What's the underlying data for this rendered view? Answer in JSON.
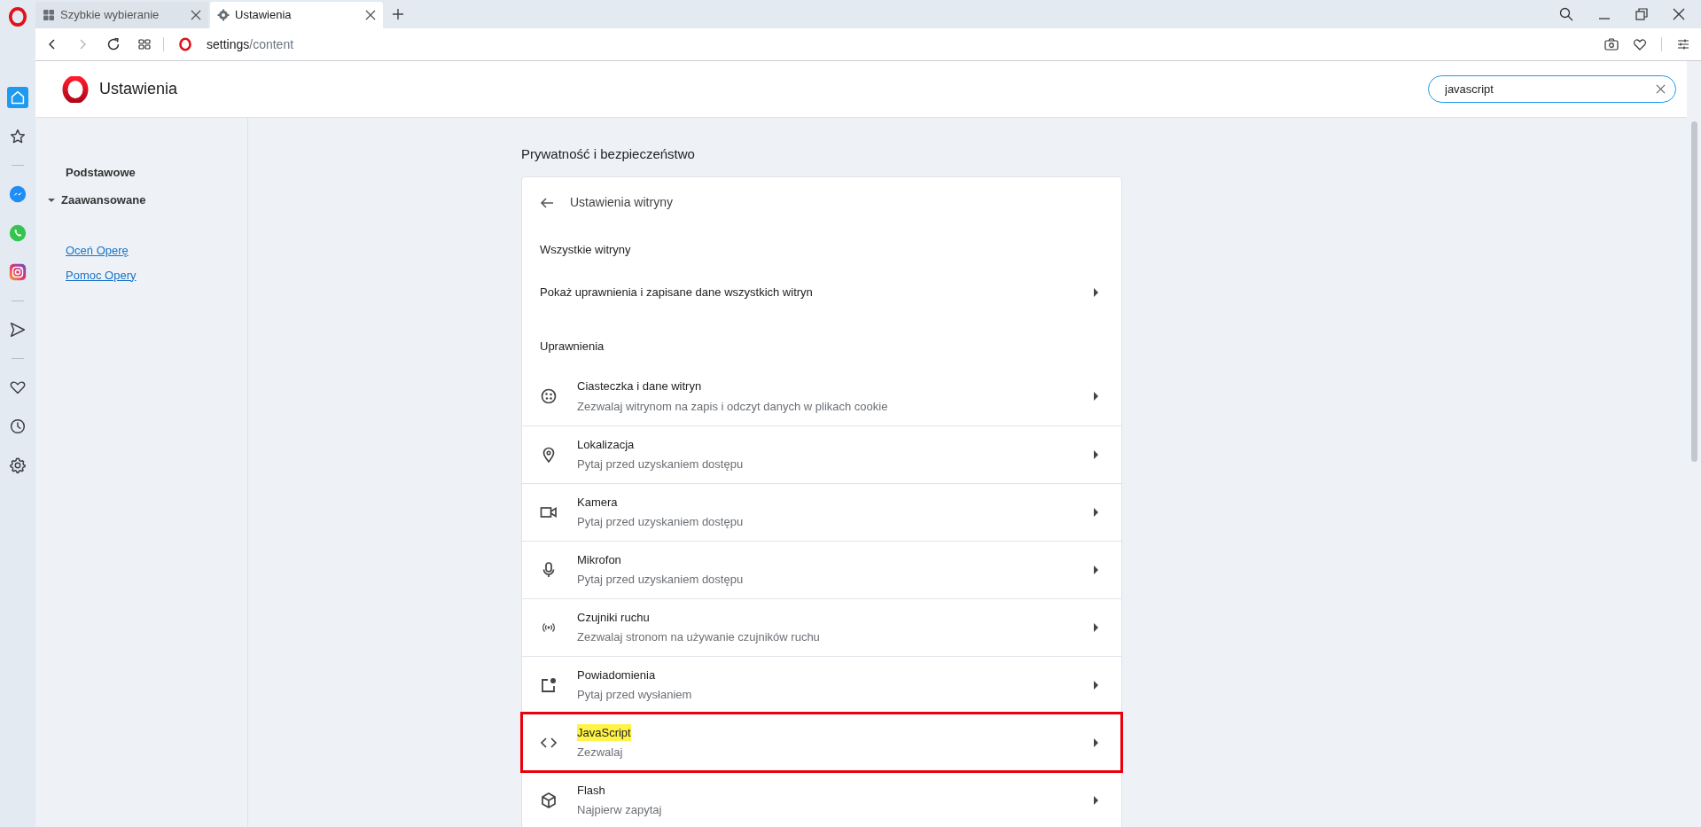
{
  "sidebar": {
    "items": [
      {
        "kind": "home",
        "selected": true
      },
      {
        "kind": "star",
        "selected": false
      },
      {
        "kind": "divider"
      },
      {
        "kind": "messenger",
        "selected": false
      },
      {
        "kind": "whatsapp",
        "selected": false
      },
      {
        "kind": "instagram",
        "selected": false
      },
      {
        "kind": "divider"
      },
      {
        "kind": "send",
        "selected": false
      },
      {
        "kind": "divider"
      },
      {
        "kind": "heart",
        "selected": false
      },
      {
        "kind": "clock",
        "selected": false
      },
      {
        "kind": "gear",
        "selected": false
      }
    ]
  },
  "tabs": [
    {
      "label": "Szybkie wybieranie",
      "kind": "grid",
      "selected": false
    },
    {
      "label": "Ustawienia",
      "kind": "gear",
      "selected": true
    }
  ],
  "address": {
    "host": "settings",
    "path": "/content"
  },
  "settings_header": {
    "title": "Ustawienia",
    "search": {
      "value": "javascript"
    }
  },
  "nav": {
    "items": [
      {
        "label": "Podstawowe",
        "kind": "plain"
      },
      {
        "label": "Zaawansowane",
        "kind": "expandable",
        "expanded": true
      }
    ],
    "links": [
      "Oceń Operę",
      "Pomoc Opery"
    ]
  },
  "section": {
    "title": "Prywatność i bezpieczeństwo",
    "card": {
      "title": "Ustawienia witryny",
      "all_sites_heading": "Wszystkie witryny",
      "all_sites_row": "Pokaż uprawnienia i zapisane dane wszystkich witryn",
      "permissions_heading": "Uprawnienia",
      "rows": [
        {
          "kind": "cookie",
          "title": "Ciasteczka i dane witryn",
          "subtitle": "Zezwalaj witrynom na zapis i odczyt danych w plikach cookie",
          "highlighted": false
        },
        {
          "kind": "location",
          "title": "Lokalizacja",
          "subtitle": "Pytaj przed uzyskaniem dostępu",
          "highlighted": false
        },
        {
          "kind": "camera",
          "title": "Kamera",
          "subtitle": "Pytaj przed uzyskaniem dostępu",
          "highlighted": false
        },
        {
          "kind": "microphone",
          "title": "Mikrofon",
          "subtitle": "Pytaj przed uzyskaniem dostępu",
          "highlighted": false
        },
        {
          "kind": "sensors",
          "title": "Czujniki ruchu",
          "subtitle": "Zezwalaj stronom na używanie czujników ruchu",
          "highlighted": false
        },
        {
          "kind": "notifications",
          "title": "Powiadomienia",
          "subtitle": "Pytaj przed wysłaniem",
          "highlighted": false
        },
        {
          "kind": "code",
          "title": "JavaScript",
          "subtitle": "Zezwalaj",
          "highlighted": true
        },
        {
          "kind": "flash",
          "title": "Flash",
          "subtitle": "Najpierw zapytaj",
          "highlighted": false
        }
      ]
    }
  }
}
